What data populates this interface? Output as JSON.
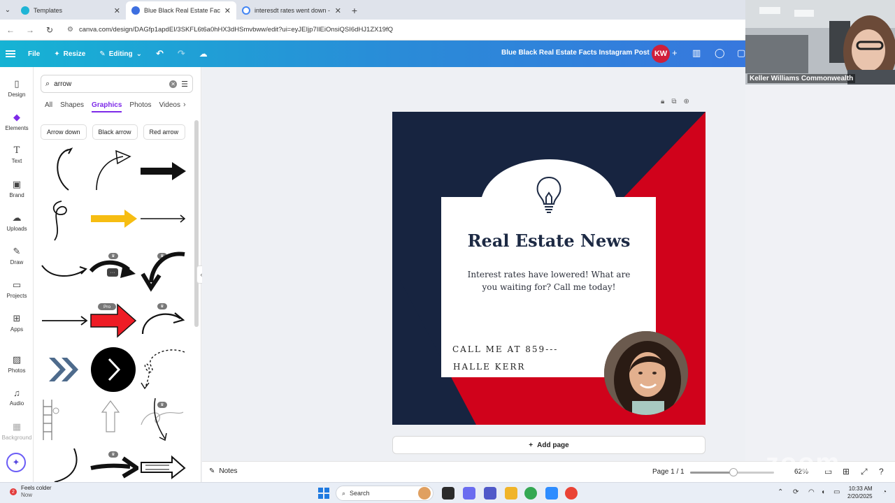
{
  "browser": {
    "tabs": [
      {
        "title": "Templates",
        "active": false
      },
      {
        "title": "Blue Black Real Estate Facts Inst",
        "active": true
      },
      {
        "title": "interesdt rates went down - G",
        "active": false
      }
    ],
    "url": "canva.com/design/DAGfp1apdEI/3SKFL6t6a0hHX3dHSmvbww/edit?ui=eyJEIjp7IlEiOnsiQSI6dHJ1ZX19fQ"
  },
  "header": {
    "file_label": "File",
    "resize_label": "Resize",
    "editing_label": "Editing",
    "doc_title": "Blue Black Real Estate Facts Instagram Post",
    "avatar_initials": "KW",
    "brand_gradient": [
      "#16b3d4",
      "#3d6fe0"
    ]
  },
  "rail": {
    "items": [
      {
        "label": "Design",
        "icon": "layout-icon"
      },
      {
        "label": "Elements",
        "icon": "shapes-icon",
        "active": true
      },
      {
        "label": "Text",
        "icon": "text-icon"
      },
      {
        "label": "Brand",
        "icon": "briefcase-icon"
      },
      {
        "label": "Uploads",
        "icon": "cloud-upload-icon"
      },
      {
        "label": "Draw",
        "icon": "pen-icon"
      },
      {
        "label": "Projects",
        "icon": "folder-icon"
      },
      {
        "label": "Apps",
        "icon": "apps-icon"
      },
      {
        "label": "Photos",
        "icon": "image-icon"
      },
      {
        "label": "Audio",
        "icon": "music-icon"
      },
      {
        "label": "Background",
        "icon": "pattern-icon"
      }
    ]
  },
  "panel": {
    "search_value": "arrow",
    "tabs": [
      "All",
      "Shapes",
      "Graphics",
      "Photos",
      "Videos"
    ],
    "active_tab": "Graphics",
    "chips": [
      "Arrow down",
      "Black arrow",
      "Red arrow"
    ],
    "pro_label": "Pro",
    "accent": "#7d2ae8"
  },
  "design": {
    "title": "Real Estate News",
    "body": "Interest rates have lowered! What are you waiting for? Call me today!",
    "call_line": "CALL ME AT 859---",
    "name_line": "HALLE KERR",
    "colors": {
      "navy": "#172440",
      "red": "#d0021b",
      "card": "#ffffff"
    }
  },
  "canvas": {
    "add_page_label": "Add page"
  },
  "footer": {
    "notes_label": "Notes",
    "page_indicator": "Page 1 / 1",
    "zoom_value": "62%",
    "zoom_fraction": 0.52
  },
  "webcam": {
    "name": "Keller Williams Commonwealth"
  },
  "taskbar": {
    "weather_badge": "2",
    "weather_text": "Feels colder",
    "weather_sub": "Now",
    "search_label": "Search",
    "time": "10:33 AM",
    "date": "2/20/2025"
  }
}
